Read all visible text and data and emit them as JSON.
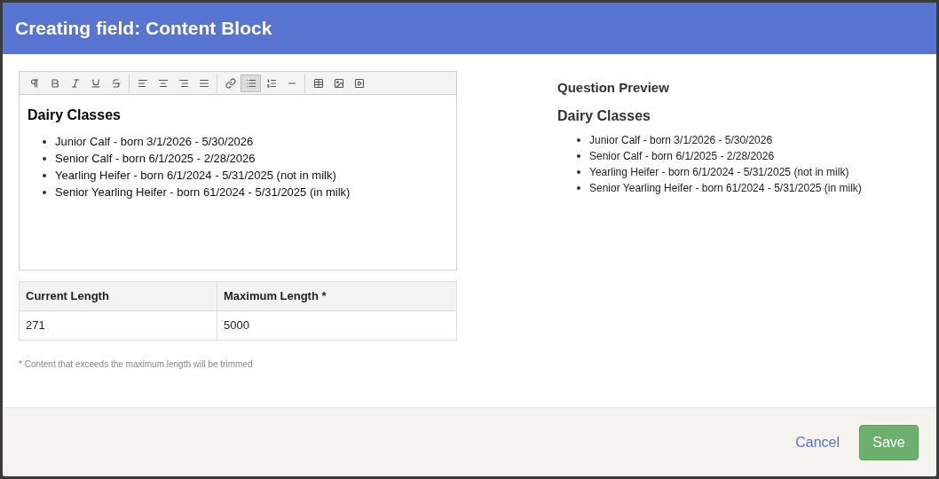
{
  "dialog": {
    "title": "Creating field: Content Block"
  },
  "toolbar": [
    {
      "kind": "paragraph",
      "selected": false
    },
    {
      "kind": "bold",
      "selected": false
    },
    {
      "kind": "italic",
      "selected": false
    },
    {
      "kind": "underline",
      "selected": false
    },
    {
      "kind": "strike",
      "selected": false
    },
    {
      "kind": "sep"
    },
    {
      "kind": "align-left",
      "selected": false
    },
    {
      "kind": "align-center",
      "selected": false
    },
    {
      "kind": "align-right",
      "selected": false
    },
    {
      "kind": "align-justify",
      "selected": false
    },
    {
      "kind": "sep"
    },
    {
      "kind": "link",
      "selected": false
    },
    {
      "kind": "bullet-list",
      "selected": true
    },
    {
      "kind": "numbered-list",
      "selected": false
    },
    {
      "kind": "rule",
      "selected": false
    },
    {
      "kind": "sep"
    },
    {
      "kind": "table",
      "selected": false
    },
    {
      "kind": "image",
      "selected": false
    },
    {
      "kind": "video",
      "selected": false
    }
  ],
  "editor": {
    "heading": "Dairy Classes",
    "items": [
      "Junior Calf - born 3/1/2026 - 5/30/2026",
      "Senior Calf - born 6/1/2025 - 2/28/2026",
      "Yearling Heifer - born 6/1/2024 - 5/31/2025 (not in milk)",
      "Senior Yearling Heifer - born 61/2024 - 5/31/2025 (in milk)"
    ]
  },
  "length_table": {
    "columns": [
      "Current Length",
      "Maximum Length *"
    ],
    "rows": [
      [
        "271",
        "5000"
      ]
    ]
  },
  "note": "* Content that exceeds the maximum length will be trimmed",
  "preview": {
    "title": "Question Preview",
    "heading": "Dairy Classes",
    "items": [
      "Junior Calf - born 3/1/2026 - 5/30/2026",
      "Senior Calf - born 6/1/2025 - 2/28/2026",
      "Yearling Heifer - born 6/1/2024 - 5/31/2025 (not in milk)",
      "Senior Yearling Heifer - born 61/2024 - 5/31/2025 (in milk)"
    ]
  },
  "buttons": {
    "cancel": "Cancel",
    "save": "Save"
  }
}
